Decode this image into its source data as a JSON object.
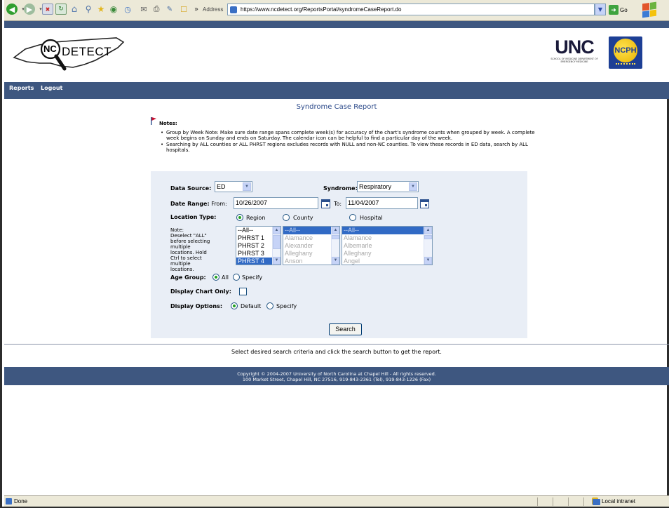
{
  "browser": {
    "address_label": "Address",
    "url": "https://www.ncdetect.org/ReportsPortal/syndromeCaseReport.do",
    "go_label": "Go"
  },
  "header": {
    "logo_text": "DETECT",
    "logo_nc": "NC",
    "unc_text": "UNC",
    "unc_sub": "SCHOOL OF MEDICINE DEPARTMENT OF EMERGENCY MEDICINE",
    "ncph_text": "NCPH"
  },
  "nav": {
    "reports": "Reports",
    "logout": "Logout"
  },
  "page": {
    "title": "Syndrome Case Report",
    "notes_title": "Notes:",
    "notes": [
      "Group by Week Note: Make sure date range spans complete week(s) for accuracy of the chart's syndrome counts when grouped by week. A complete week begins on Sunday and ends on Saturday. The calendar icon can be helpful to find a particular day of the week.",
      "Searching by ALL counties or ALL PHRST regions excludes records with NULL and non-NC counties. To view these records in ED data, search by ALL hospitals."
    ]
  },
  "form": {
    "data_source_label": "Data Source:",
    "data_source_value": "ED",
    "syndrome_label": "Syndrome:",
    "syndrome_value": "Respiratory",
    "date_range_label": "Date Range:",
    "from_label": "From:",
    "from_value": "10/26/2007",
    "to_label": "To:",
    "to_value": "11/04/2007",
    "location_type_label": "Location Type:",
    "location_options": [
      "Region",
      "County",
      "Hospital"
    ],
    "location_selected": "Region",
    "location_note": "Note:\nDeselect \"ALL\" before selecting multiple locations. Hold Ctrl to select multiple locations.",
    "region_list": [
      "--All--",
      "PHRST 1",
      "PHRST 2",
      "PHRST 3",
      "PHRST 4"
    ],
    "county_list": [
      "--All--",
      "Alamance",
      "Alexander",
      "Alleghany",
      "Anson"
    ],
    "hospital_list": [
      "--All--",
      "Alamance",
      "Albemarle",
      "Alleghany",
      "Angel"
    ],
    "age_group_label": "Age Group:",
    "age_options": [
      "All",
      "Specify"
    ],
    "display_chart_label": "Display Chart Only:",
    "display_chart_checked": false,
    "display_options_label": "Display Options:",
    "display_options": [
      "Default",
      "Specify"
    ],
    "search_label": "Search"
  },
  "hint": "Select desired search criteria and click the search button to get the report.",
  "footer": {
    "line1": "Copyright © 2004-2007 University of North Carolina at Chapel Hill - All rights reserved.",
    "line2": "100 Market Street, Chapel Hill, NC 27516, 919-843-2361 (Tel), 919-843-1226 (Fax)"
  },
  "status": {
    "text": "Done",
    "zone": "Local intranet"
  }
}
